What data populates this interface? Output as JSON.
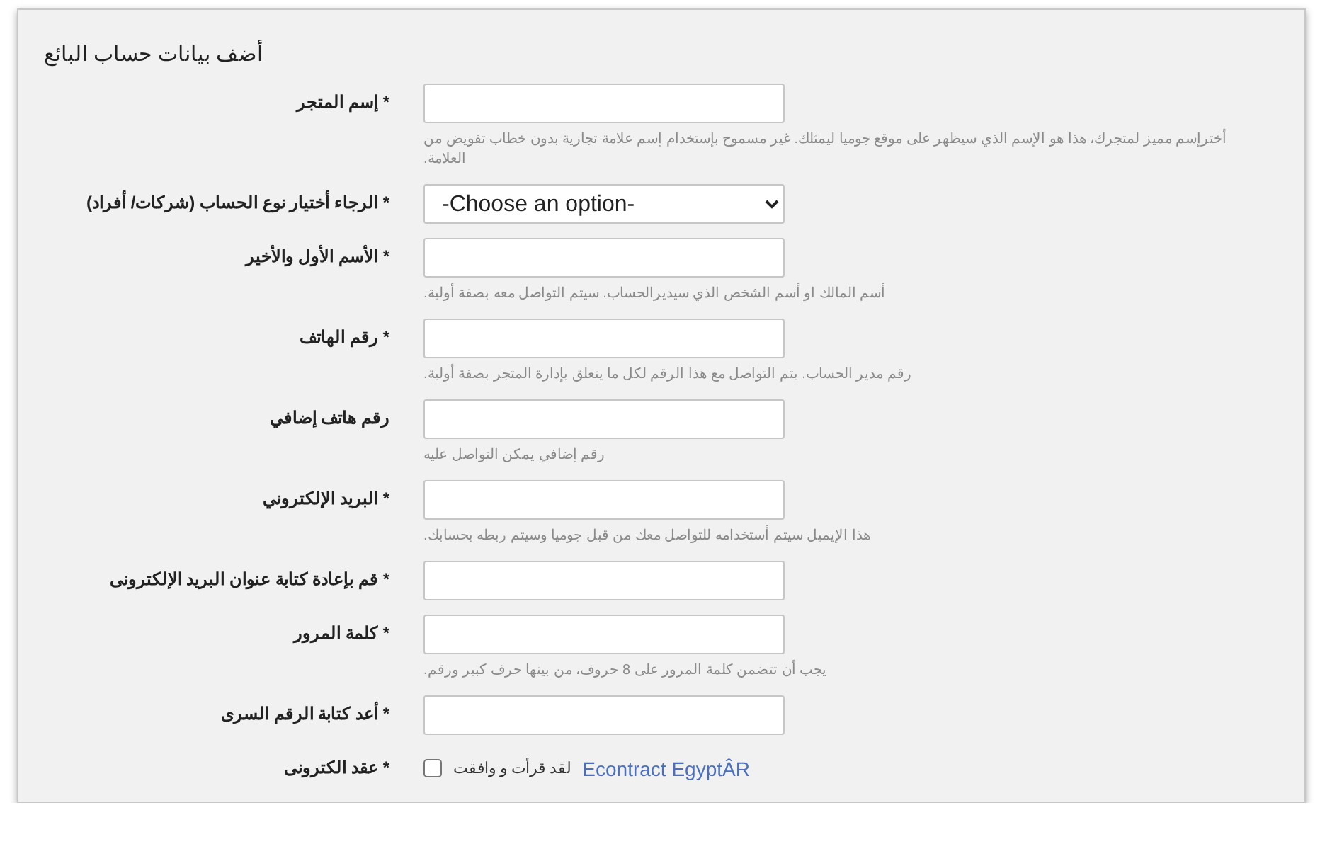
{
  "title": "أضف بيانات حساب البائع",
  "fields": [
    {
      "kind": "text",
      "label": "* إسم المتجر",
      "hint": "أخترإسم مميز لمتجرك، هذا هو الإسم الذي سيظهر على موقع جوميا ليمثلك. غير مسموح بإستخدام إسم علامة تجارية بدون خطاب تفويض من العلامة."
    },
    {
      "kind": "select",
      "label": "* الرجاء أختيار نوع الحساب (شركات/ أفراد)",
      "value": "-Choose an option-"
    },
    {
      "kind": "text",
      "label": "* الأسم الأول والأخير",
      "hint": "أسم المالك او أسم الشخص الذي سيديرالحساب. سيتم التواصل معه بصفة أولية."
    },
    {
      "kind": "text",
      "label": "* رقم الهاتف",
      "hint": "رقم مدير الحساب. يتم التواصل مع هذا الرقم لكل ما يتعلق بإدارة المتجر بصفة أولية."
    },
    {
      "kind": "text",
      "label": "رقم هاتف إضافي",
      "hint": "رقم إضافي يمكن التواصل عليه"
    },
    {
      "kind": "text",
      "label": "* البريد الإلكتروني",
      "hint": "هذا الإيميل سيتم أستخدامه للتواصل معك من قبل جوميا وسيتم ربطه بحسابك."
    },
    {
      "kind": "text",
      "label": "* قم بإعادة كتابة عنوان البريد الإلكترونى"
    },
    {
      "kind": "text",
      "label": "* كلمة المرور",
      "hint": "يجب أن تتضمن كلمة المرور على 8 حروف، من بينها حرف كبير ورقم."
    },
    {
      "kind": "text",
      "label": "* أعد كتابة الرقم السرى"
    },
    {
      "kind": "checkbox",
      "label": "* عقد الكترونى",
      "checked": false,
      "text": "لقد قرأت و وافقت",
      "link": "Econtract EgyptÂR"
    }
  ]
}
